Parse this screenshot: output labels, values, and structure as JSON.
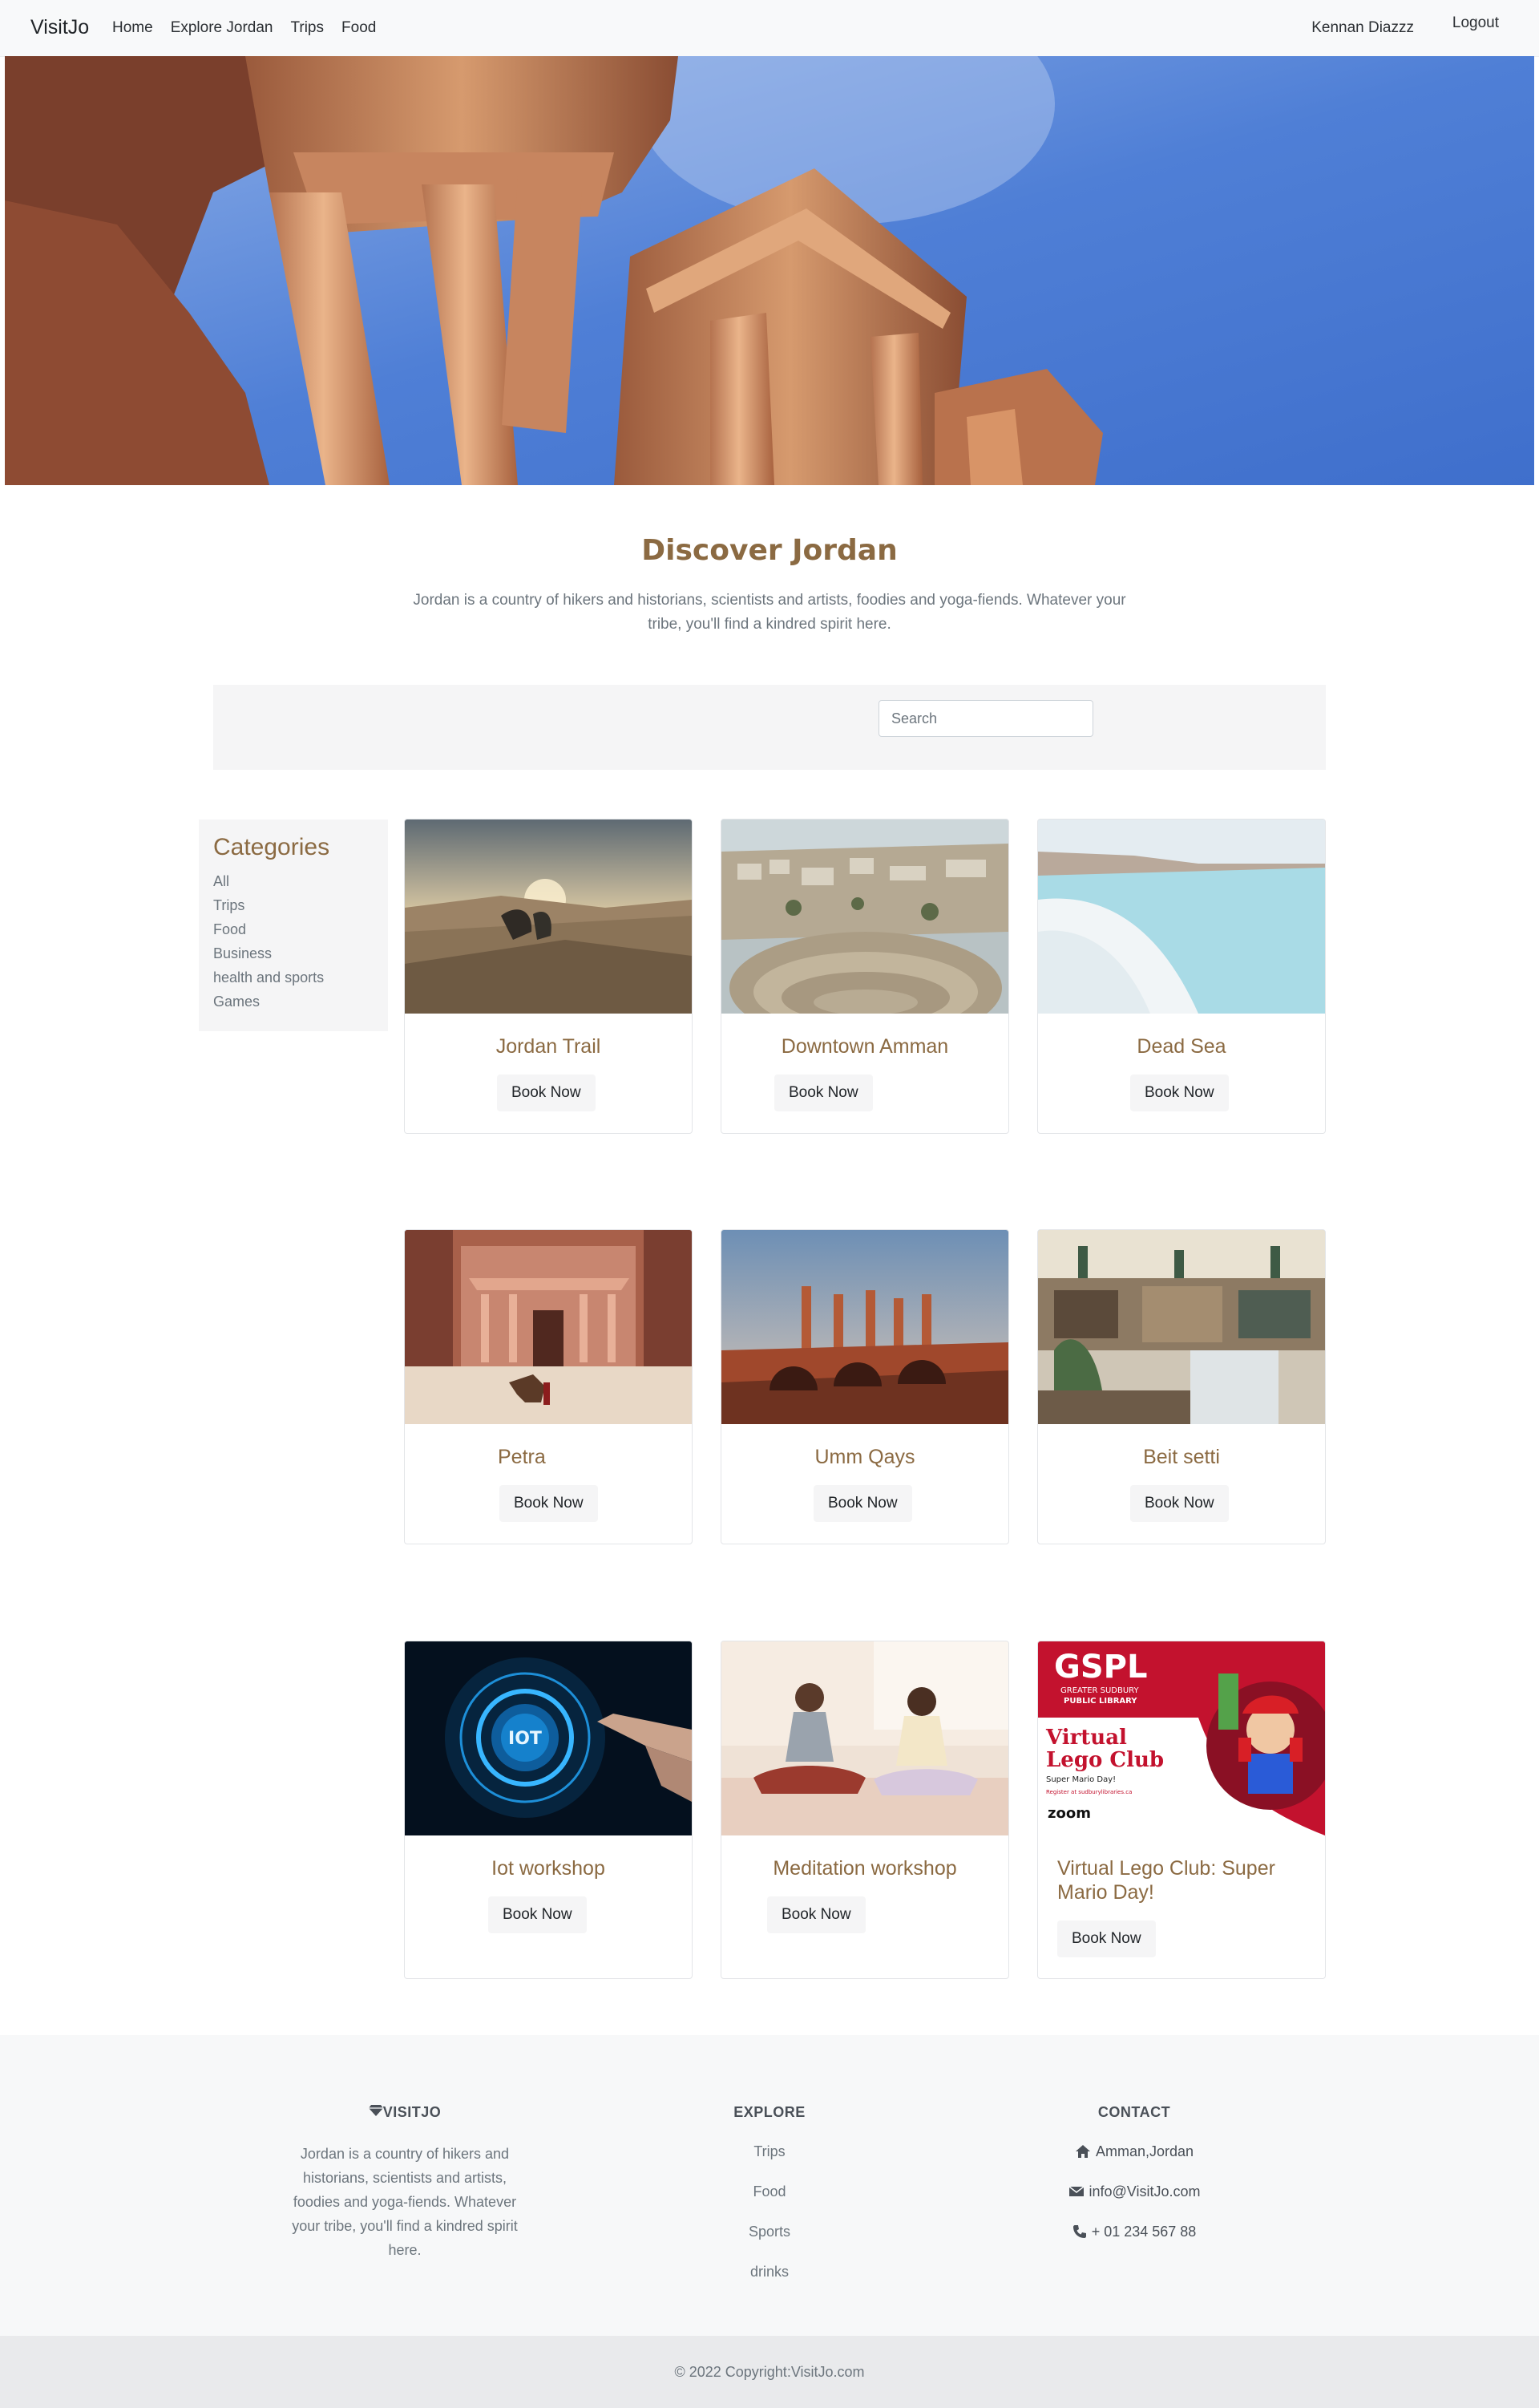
{
  "nav": {
    "brand": "VisitJo",
    "links": [
      "Home",
      "Explore Jordan",
      "Trips",
      "Food"
    ],
    "user": "Kennan Diazzz",
    "logout": "Logout"
  },
  "intro": {
    "title": "Discover Jordan",
    "text": "Jordan is a country of hikers and historians, scientists and artists, foodies and yoga-fiends. Whatever your tribe, you'll find a kindred spirit here."
  },
  "search": {
    "placeholder": "Search"
  },
  "categories": {
    "title": "Categories",
    "items": [
      "All",
      "Trips",
      "Food",
      "Business",
      "health and sports",
      "Games"
    ]
  },
  "cards": [
    {
      "title": "Jordan Trail",
      "button": "Book Now"
    },
    {
      "title": "Downtown Amman",
      "button": "Book Now"
    },
    {
      "title": "Dead Sea",
      "button": "Book Now"
    },
    {
      "title": "Petra",
      "button": "Book Now"
    },
    {
      "title": "Umm Qays",
      "button": "Book Now"
    },
    {
      "title": "Beit setti",
      "button": "Book Now"
    },
    {
      "title": "Iot workshop",
      "button": "Book Now"
    },
    {
      "title": "Meditation workshop",
      "button": "Book Now"
    },
    {
      "title": "Virtual Lego Club: Super Mario Day!",
      "button": "Book Now"
    }
  ],
  "card_images": {
    "iot_label": "IOT",
    "gspl": {
      "title": "GSPL",
      "subtitle_1": "GREATER SUDBURY",
      "subtitle_2": "PUBLIC LIBRARY",
      "heading_1": "Virtual",
      "heading_2": "Lego Club",
      "tag": "Super Mario Day!",
      "register": "Register at sudburylibraries.ca",
      "zoom": "zoom"
    }
  },
  "footer": {
    "brand_heading": "VISITJO",
    "brand_text": "Jordan is a country of hikers and historians, scientists and artists, foodies and yoga-fiends. Whatever your tribe, you'll find a kindred spirit here.",
    "explore_heading": "EXPLORE",
    "explore_links": [
      "Trips",
      "Food",
      "Sports",
      "drinks"
    ],
    "contact_heading": "CONTACT",
    "address": "Amman,Jordan",
    "email": "info@VisitJo.com",
    "phone": "+ 01 234 567 88",
    "copyright": "© 2022 Copyright:VisitJo.com"
  },
  "colors": {
    "accent": "#8b6a42",
    "muted": "#6c757d",
    "panel": "#f5f5f6"
  }
}
